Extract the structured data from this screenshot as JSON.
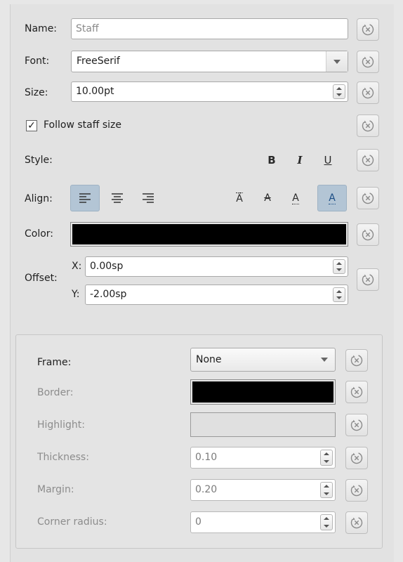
{
  "name": {
    "label": "Name:",
    "placeholder": "Staff"
  },
  "font": {
    "label": "Font:",
    "value": "FreeSerif"
  },
  "size": {
    "label": "Size:",
    "value": "10.00pt"
  },
  "follow_staff_size": {
    "label": "Follow staff size",
    "checked": true,
    "check_glyph": "✓"
  },
  "style": {
    "label": "Style:",
    "bold": "B",
    "italic": "I",
    "underline": "U"
  },
  "align": {
    "label": "Align:",
    "vertical_options": [
      "Ä",
      "A",
      "A",
      "A"
    ],
    "selected_vertical_index": 3
  },
  "color": {
    "label": "Color:",
    "value": "#000000"
  },
  "offset": {
    "label": "Offset:",
    "x_label": "X:",
    "x_value": "0.00sp",
    "y_label": "Y:",
    "y_value": "-2.00sp"
  },
  "frame_section": {
    "frame": {
      "label": "Frame:",
      "value": "None"
    },
    "border": {
      "label": "Border:",
      "color": "#000000"
    },
    "highlight": {
      "label": "Highlight:",
      "color": "#e0e0e0"
    },
    "thickness": {
      "label": "Thickness:",
      "value": "0.10"
    },
    "margin": {
      "label": "Margin:",
      "value": "0.20"
    },
    "corner_radius": {
      "label": "Corner radius:",
      "value": "0"
    }
  },
  "icons": {
    "reset": "reset-to-default-icon"
  }
}
